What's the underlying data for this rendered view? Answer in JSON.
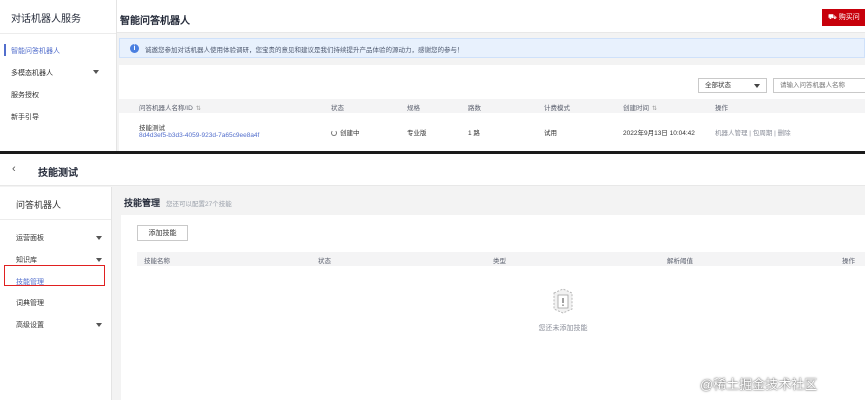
{
  "top": {
    "sidebar": {
      "service_title": "对话机器人服务",
      "items": [
        {
          "label": "智能问答机器人",
          "active": true
        },
        {
          "label": "多模态机器人",
          "has_caret": true
        },
        {
          "label": "服务授权"
        },
        {
          "label": "新手引导"
        }
      ]
    },
    "header": {
      "title": "智能问答机器人",
      "buy_label": "购买问"
    },
    "notice": {
      "icon": "info-icon",
      "text": "诚邀您参加对话机器人使用体验调研，您宝贵的意见和建议是我们持续提升产品体验的源动力，感谢您的参与！"
    },
    "filters": {
      "status_value": "全部状态",
      "search_placeholder": "请输入问答机器人名称"
    },
    "table": {
      "columns": [
        "问答机器人名称/ID",
        "状态",
        "规格",
        "路数",
        "计费模式",
        "创建时间",
        "操作"
      ],
      "rows": [
        {
          "name": "技能测试",
          "id": "8d4d3ef5-b3d3-4059-923d-7a65c9ee8a4f",
          "status": "创建中",
          "spec": "专业版",
          "lines": "1 路",
          "billing": "试用",
          "created": "2022年9月13日 10:04:42",
          "ops": [
            "机器人管理",
            "包周期",
            "删除"
          ]
        }
      ]
    }
  },
  "bottom": {
    "header": {
      "back_icon": "chevron-left-icon",
      "title": "技能测试"
    },
    "sidebar": {
      "bot_name": "问答机器人",
      "items": [
        {
          "label": "运营面板",
          "has_caret": true
        },
        {
          "label": "知识库",
          "has_caret": true
        },
        {
          "label": "技能管理",
          "active": true
        },
        {
          "label": "词典管理"
        },
        {
          "label": "高级设置",
          "has_caret": true
        }
      ]
    },
    "content": {
      "title": "技能管理",
      "subtitle": "您还可以配置27个技能",
      "add_button": "添加技能",
      "columns": [
        "技能名称",
        "状态",
        "类型",
        "解析阈值",
        "操作"
      ],
      "empty_text": "您还未添加技能",
      "empty_icon": "empty-box-icon"
    }
  },
  "watermark": "@稀土掘金技术社区",
  "colors": {
    "accent": "#526ecc",
    "buy_red": "#c7000b",
    "highlight_red": "#e02020",
    "notice_bg": "#e8f1fd"
  }
}
